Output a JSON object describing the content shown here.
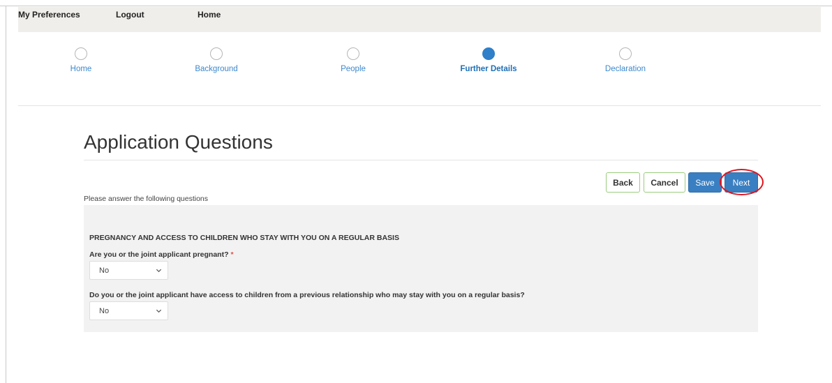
{
  "topnav": {
    "links": [
      "My Preferences",
      "Logout",
      "Home"
    ]
  },
  "steps": [
    {
      "label": "Home",
      "active": false
    },
    {
      "label": "Background",
      "active": false
    },
    {
      "label": "People",
      "active": false
    },
    {
      "label": "Further Details",
      "active": true
    },
    {
      "label": "Declaration",
      "active": false
    }
  ],
  "page": {
    "title": "Application Questions",
    "instructions": "Please answer the following questions"
  },
  "actions": {
    "back": "Back",
    "cancel": "Cancel",
    "save": "Save",
    "next": "Next"
  },
  "form": {
    "section_heading": "PREGNANCY AND ACCESS TO CHILDREN WHO STAY WITH YOU ON A REGULAR BASIS",
    "questions": [
      {
        "label": "Are you or the joint applicant pregnant?",
        "required_mark": "*",
        "value": "No"
      },
      {
        "label": "Do you or the joint applicant have access to children from a previous relationship who may stay with you on a regular basis?",
        "required_mark": "",
        "value": "No"
      }
    ]
  },
  "colors": {
    "accent": "#2f7fc9",
    "primary_button": "#3a7fc1",
    "highlight_ring": "#e0141e",
    "required": "#d9534f"
  },
  "icons": [
    "chevron-down-icon"
  ]
}
